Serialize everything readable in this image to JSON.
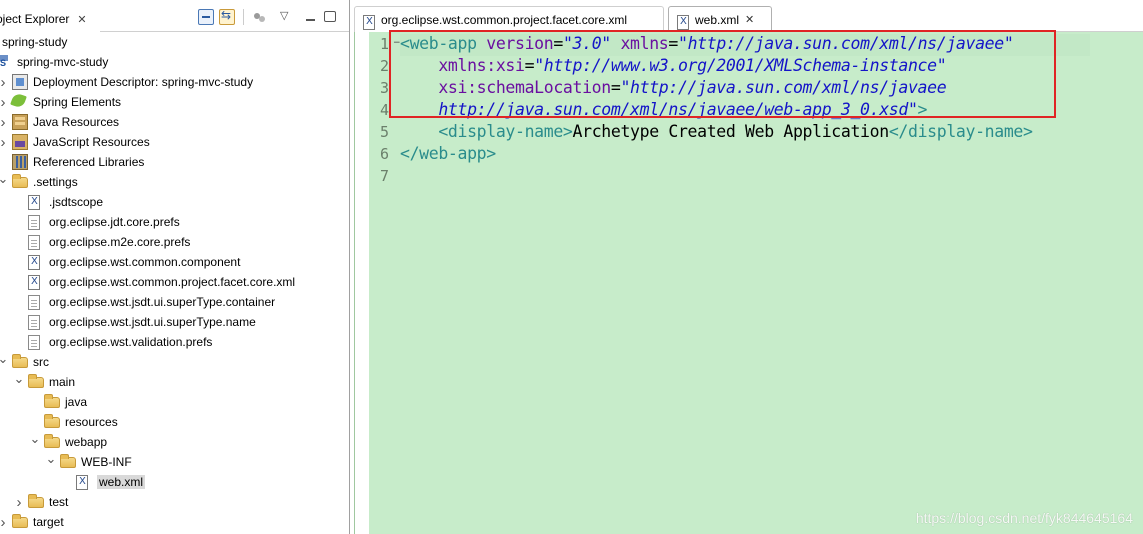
{
  "explorer": {
    "title": "oject Explorer",
    "close": "✕",
    "menu": "▽",
    "tree": [
      {
        "label": "spring-study",
        "level": 0,
        "chevron": "",
        "icon": "none"
      },
      {
        "label": "spring-mvc-study",
        "level": 0,
        "chevron": "",
        "icon": "project"
      },
      {
        "label": "Deployment Descriptor: spring-mvc-study",
        "level": 1,
        "chevron": ">",
        "icon": "dd"
      },
      {
        "label": "Spring Elements",
        "level": 1,
        "chevron": ">",
        "icon": "spring"
      },
      {
        "label": "Java Resources",
        "level": 1,
        "chevron": ">",
        "icon": "jres"
      },
      {
        "label": "JavaScript Resources",
        "level": 1,
        "chevron": ">",
        "icon": "jsres"
      },
      {
        "label": "Referenced Libraries",
        "level": 1,
        "chevron": "",
        "icon": "lib"
      },
      {
        "label": ".settings",
        "level": 1,
        "chevron": "v",
        "icon": "folder"
      },
      {
        "label": ".jsdtscope",
        "level": 2,
        "chevron": "",
        "icon": "xml"
      },
      {
        "label": "org.eclipse.jdt.core.prefs",
        "level": 2,
        "chevron": "",
        "icon": "file"
      },
      {
        "label": "org.eclipse.m2e.core.prefs",
        "level": 2,
        "chevron": "",
        "icon": "file"
      },
      {
        "label": "org.eclipse.wst.common.component",
        "level": 2,
        "chevron": "",
        "icon": "xml"
      },
      {
        "label": "org.eclipse.wst.common.project.facet.core.xml",
        "level": 2,
        "chevron": "",
        "icon": "xml"
      },
      {
        "label": "org.eclipse.wst.jsdt.ui.superType.container",
        "level": 2,
        "chevron": "",
        "icon": "file"
      },
      {
        "label": "org.eclipse.wst.jsdt.ui.superType.name",
        "level": 2,
        "chevron": "",
        "icon": "file"
      },
      {
        "label": "org.eclipse.wst.validation.prefs",
        "level": 2,
        "chevron": "",
        "icon": "file"
      },
      {
        "label": "src",
        "level": 1,
        "chevron": "v",
        "icon": "folder"
      },
      {
        "label": "main",
        "level": 2,
        "chevron": "v",
        "icon": "folder"
      },
      {
        "label": "java",
        "level": 3,
        "chevron": "",
        "icon": "folder"
      },
      {
        "label": "resources",
        "level": 3,
        "chevron": "",
        "icon": "folder"
      },
      {
        "label": "webapp",
        "level": 3,
        "chevron": "v",
        "icon": "folder"
      },
      {
        "label": "WEB-INF",
        "level": 4,
        "chevron": "v",
        "icon": "folder"
      },
      {
        "label": "web.xml",
        "level": 5,
        "chevron": "",
        "icon": "xml",
        "selected": true
      },
      {
        "label": "test",
        "level": 2,
        "chevron": ">",
        "icon": "folder"
      },
      {
        "label": "target",
        "level": 1,
        "chevron": ">",
        "icon": "folder"
      }
    ]
  },
  "editor": {
    "tabs": [
      {
        "label": "org.eclipse.wst.common.project.facet.core.xml",
        "close": "",
        "active": false
      },
      {
        "label": "web.xml",
        "close": "✕",
        "active": true
      }
    ],
    "line_numbers": [
      "1",
      "2",
      "3",
      "4",
      "5",
      "6",
      "7"
    ],
    "fold_marker": "−",
    "lines": [
      [
        {
          "c": "tag",
          "t": "<web-app "
        },
        {
          "c": "attr",
          "t": "version"
        },
        {
          "c": "txt",
          "t": "="
        },
        {
          "c": "val",
          "t": "\"3.0\""
        },
        {
          "c": "txt",
          "t": " "
        },
        {
          "c": "attr",
          "t": "xmlns"
        },
        {
          "c": "txt",
          "t": "="
        },
        {
          "c": "val",
          "t": "\"http://java.sun.com/xml/ns/javaee\""
        }
      ],
      [
        {
          "c": "txt",
          "t": "    "
        },
        {
          "c": "attr",
          "t": "xmlns:xsi"
        },
        {
          "c": "txt",
          "t": "="
        },
        {
          "c": "val",
          "t": "\"http://www.w3.org/2001/XMLSchema-instance\""
        }
      ],
      [
        {
          "c": "txt",
          "t": "    "
        },
        {
          "c": "attr",
          "t": "xsi:schemaLocation"
        },
        {
          "c": "txt",
          "t": "="
        },
        {
          "c": "val",
          "t": "\"http://java.sun.com/xml/ns/javaee"
        }
      ],
      [
        {
          "c": "txt",
          "t": "    "
        },
        {
          "c": "val",
          "t": "http://java.sun.com/xml/ns/javaee/web-app_3_0.xsd\""
        },
        {
          "c": "tag",
          "t": ">"
        }
      ],
      [
        {
          "c": "txt",
          "t": "    "
        },
        {
          "c": "tag",
          "t": "<display-name>"
        },
        {
          "c": "txt",
          "t": "Archetype Created Web Application"
        },
        {
          "c": "tag",
          "t": "</display-name>"
        }
      ],
      [
        {
          "c": "tag",
          "t": "</web-app>"
        }
      ],
      []
    ]
  },
  "watermark": "https://blog.csdn.net/fyk844645164",
  "colors": {
    "editor_bg": "#c7ecca",
    "highlight_box": "#e02424",
    "tag": "#2a8c8c",
    "attribute": "#6a0fa0",
    "value": "#1414c8"
  }
}
